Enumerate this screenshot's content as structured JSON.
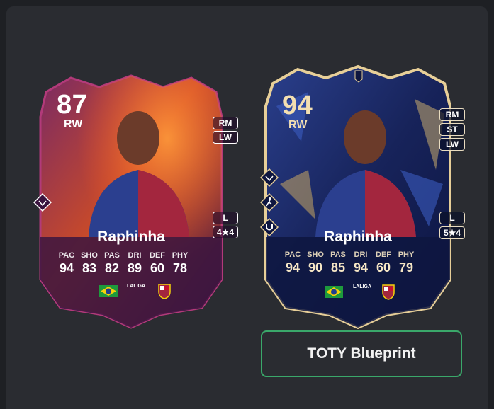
{
  "cards": [
    {
      "rating": "87",
      "position": "RW",
      "alt_positions": [
        "RM",
        "LW"
      ],
      "foot": "L",
      "skills_weakfoot": "4★4",
      "name": "Raphinha",
      "stats": [
        {
          "label": "PAC",
          "value": "94"
        },
        {
          "label": "SHO",
          "value": "83"
        },
        {
          "label": "PAS",
          "value": "82"
        },
        {
          "label": "DRI",
          "value": "89"
        },
        {
          "label": "DEF",
          "value": "60"
        },
        {
          "label": "PHY",
          "value": "78"
        }
      ],
      "league_text": "LALIGA"
    },
    {
      "rating": "94",
      "position": "RW",
      "alt_positions": [
        "RM",
        "ST",
        "LW"
      ],
      "foot": "L",
      "skills_weakfoot": "5★4",
      "name": "Raphinha",
      "stats": [
        {
          "label": "PAC",
          "value": "94"
        },
        {
          "label": "SHO",
          "value": "90"
        },
        {
          "label": "PAS",
          "value": "85"
        },
        {
          "label": "DRI",
          "value": "94"
        },
        {
          "label": "DEF",
          "value": "60"
        },
        {
          "label": "PHY",
          "value": "79"
        }
      ],
      "league_text": "LALIGA"
    }
  ],
  "button": {
    "label": "TOTY Blueprint"
  },
  "colors": {
    "background": "#1e2024",
    "panel": "#2a2c31",
    "button_border": "#3aa86a",
    "card_left_primary": "#5a1f5c",
    "card_right_primary": "#1b2a66",
    "gold": "#e7cf98"
  }
}
